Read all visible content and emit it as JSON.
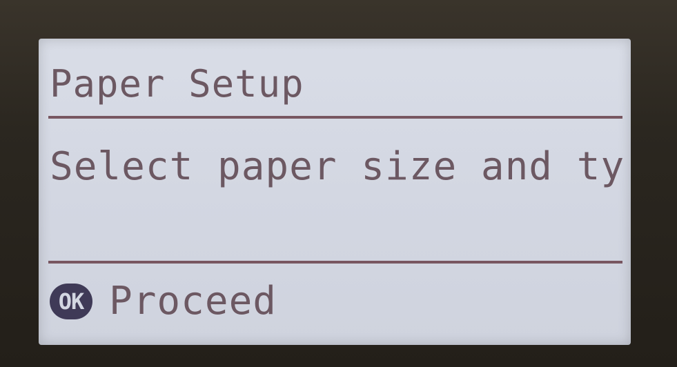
{
  "screen": {
    "title": "Paper Setup",
    "message": "Select paper size and typ",
    "footer": {
      "ok_label": "OK",
      "action_label": "Proceed"
    }
  },
  "colors": {
    "lcd_background": "#d5d9e4",
    "lcd_text": "#6c5862",
    "divider": "#6e4852",
    "ok_badge": "#3f3a57",
    "bezel": "#2b2720"
  }
}
